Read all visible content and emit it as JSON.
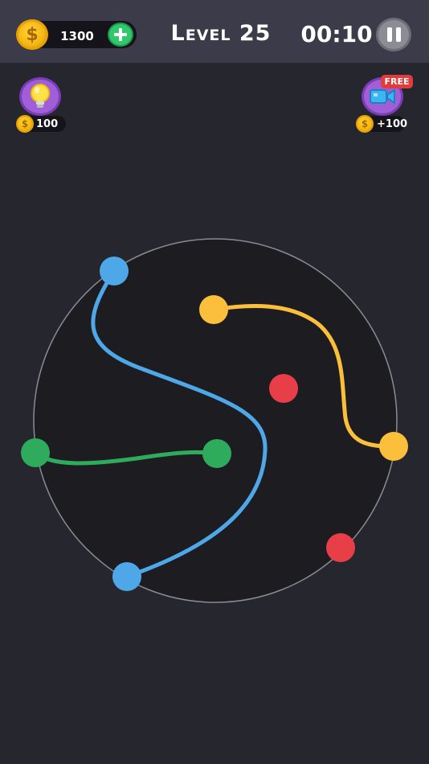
{
  "header": {
    "coins": "1300",
    "coin_symbol": "$",
    "level_title": "Level 25",
    "timer": "00:10"
  },
  "powerups": {
    "hint": {
      "icon": "lightbulb-icon",
      "coin_symbol": "$",
      "price": "100"
    },
    "video": {
      "icon": "video-camera-icon",
      "badge": "FREE",
      "coin_symbol": "$",
      "reward": "+100"
    }
  },
  "colors": {
    "blue": "#4ea8e8",
    "green": "#2eab5c",
    "yellow": "#fbbf3c",
    "red": "#e83e48",
    "board": "#1c1c21",
    "board_rim": "#8a8a94"
  },
  "dots": [
    {
      "name": "blue-dot-top",
      "color": "blue"
    },
    {
      "name": "blue-dot-bottom",
      "color": "blue"
    },
    {
      "name": "green-dot-left",
      "color": "green"
    },
    {
      "name": "green-dot-center",
      "color": "green"
    },
    {
      "name": "yellow-dot-left",
      "color": "yellow"
    },
    {
      "name": "yellow-dot-right",
      "color": "yellow"
    },
    {
      "name": "red-dot-center",
      "color": "red"
    },
    {
      "name": "red-dot-bottom",
      "color": "red"
    }
  ],
  "lines": [
    {
      "name": "blue-line",
      "color": "blue",
      "connected": true
    },
    {
      "name": "green-line",
      "color": "green",
      "connected": true
    },
    {
      "name": "yellow-line",
      "color": "yellow",
      "connected": true
    },
    {
      "name": "red-line",
      "color": "red",
      "connected": false
    }
  ]
}
